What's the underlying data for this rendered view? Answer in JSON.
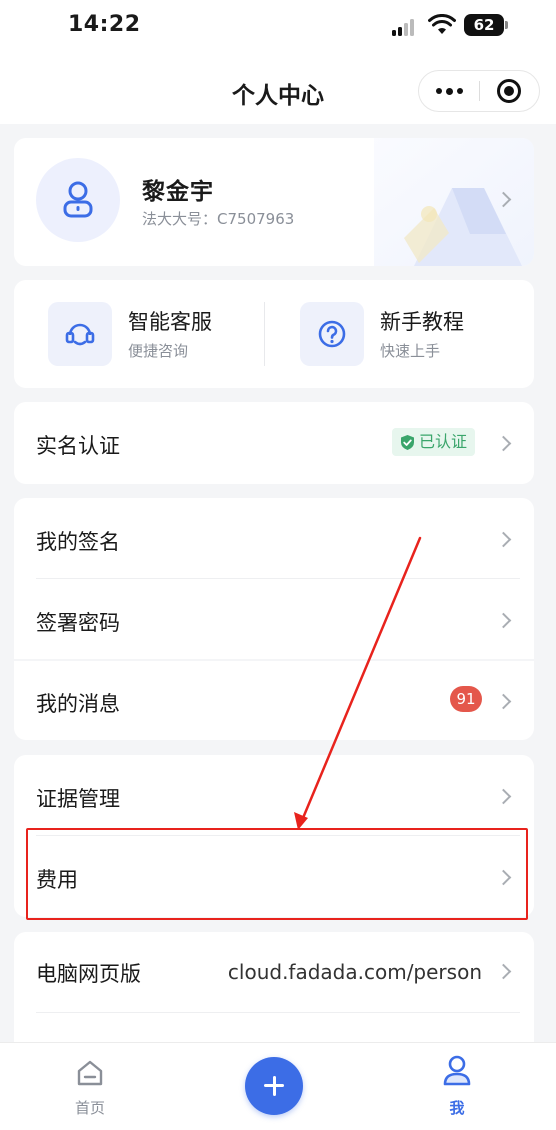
{
  "status_bar": {
    "time": "14:22",
    "battery": "62",
    "icons": [
      "signal-icon",
      "wifi-icon",
      "battery-icon"
    ]
  },
  "header": {
    "title": "个人中心",
    "icons": [
      "more-icon",
      "close-target-icon"
    ]
  },
  "profile": {
    "name": "黎金宇",
    "id_label": "法大大号：",
    "id_value": "C7507963",
    "icons": [
      "user-avatar-icon",
      "chevron-right-icon"
    ]
  },
  "quick_actions": [
    {
      "title": "智能客服",
      "subtitle": "便捷咨询",
      "icon": "headset-icon"
    },
    {
      "title": "新手教程",
      "subtitle": "快速上手",
      "icon": "question-icon"
    }
  ],
  "menu": {
    "real_name": {
      "label": "实名认证",
      "badge": "已认证",
      "badge_icon": "shield-check-icon"
    },
    "my_signature": {
      "label": "我的签名"
    },
    "sign_password": {
      "label": "签署密码"
    },
    "my_messages": {
      "label": "我的消息",
      "badge": "91"
    },
    "evidence": {
      "label": "证据管理"
    },
    "fees": {
      "label": "费用"
    },
    "web_version": {
      "label": "电脑网页版",
      "value": "cloud.fadada.com/person"
    }
  },
  "tabbar": {
    "home": "首页",
    "me": "我",
    "active_color": "#3c6de6",
    "icons": [
      "home-icon",
      "add-icon",
      "person-icon"
    ]
  },
  "colors": {
    "accent": "#3c6de6",
    "annotation": "#e8231d",
    "verified": "#3aa56b",
    "badge": "#e4574b"
  }
}
